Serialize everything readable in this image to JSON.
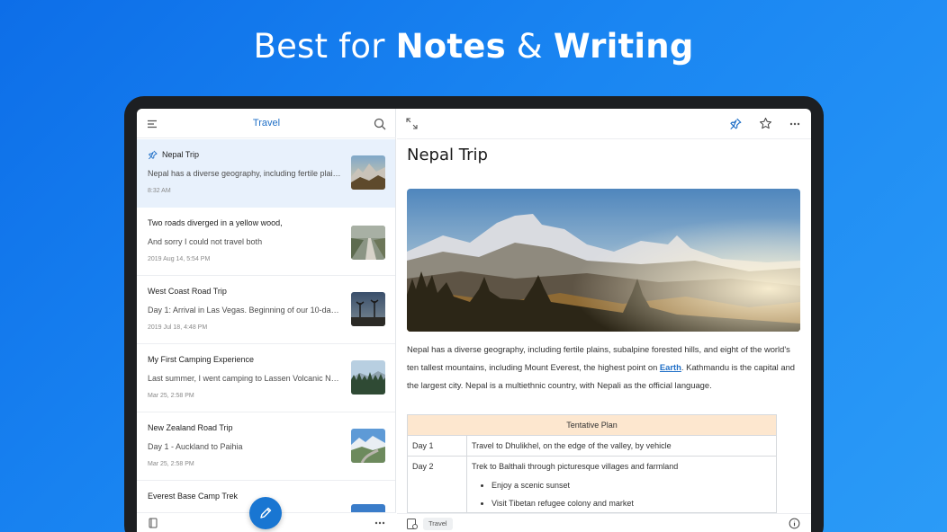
{
  "headline": {
    "prefix": "Best for ",
    "bold1": "Notes",
    "amp": " & ",
    "bold2": "Writing"
  },
  "list": {
    "title": "Travel",
    "notes": [
      {
        "title": "Nepal Trip",
        "snippet": "Nepal has a diverse geography, including fertile plain...",
        "time": "8:32 AM",
        "pinned": true
      },
      {
        "title": "Two roads diverged in a yellow wood,",
        "snippet": "And sorry I could not travel both",
        "time": "2019 Aug 14, 5:54 PM"
      },
      {
        "title": "West Coast Road Trip",
        "snippet": "Day 1: Arrival in Las Vegas. Beginning of our 10-day W...",
        "time": "2019 Jul 18, 4:48 PM"
      },
      {
        "title": "My First Camping Experience",
        "snippet": "Last summer, I went camping to Lassen Volcanic Nati...",
        "time": "Mar 25, 2:58 PM"
      },
      {
        "title": "New Zealand Road Trip",
        "snippet": "Day 1 - Auckland to Paihia",
        "time": "Mar 25, 2:58 PM"
      },
      {
        "title": "Everest Base Camp Trek",
        "snippet": "",
        "time": ""
      }
    ]
  },
  "note": {
    "title": "Nepal Trip",
    "body_before_link": "Nepal has a diverse geography, including fertile plains, subalpine forested hills, and eight of the world's ten tallest mountains, including Mount Everest, the highest point on ",
    "link_text": "Earth",
    "body_after_link": ". Kathmandu is the capital and the largest city. Nepal is a multiethnic country, with Nepali as the official language.",
    "table": {
      "header": "Tentative Plan",
      "rows": [
        {
          "day": "Day 1",
          "text": "Travel to Dhulikhel, on the edge of the valley, by vehicle"
        },
        {
          "day": "Day 2",
          "text": "Trek to Balthali through picturesque villages and farmland",
          "bullets": [
            "Enjoy a scenic sunset",
            "Visit Tibetan refugee colony and market"
          ]
        }
      ]
    },
    "tag": "Travel"
  },
  "colors": {
    "accent": "#1f6fc7",
    "selected_row": "#e8f1fc",
    "table_header": "#fde7cf",
    "fab": "#1976d2"
  }
}
